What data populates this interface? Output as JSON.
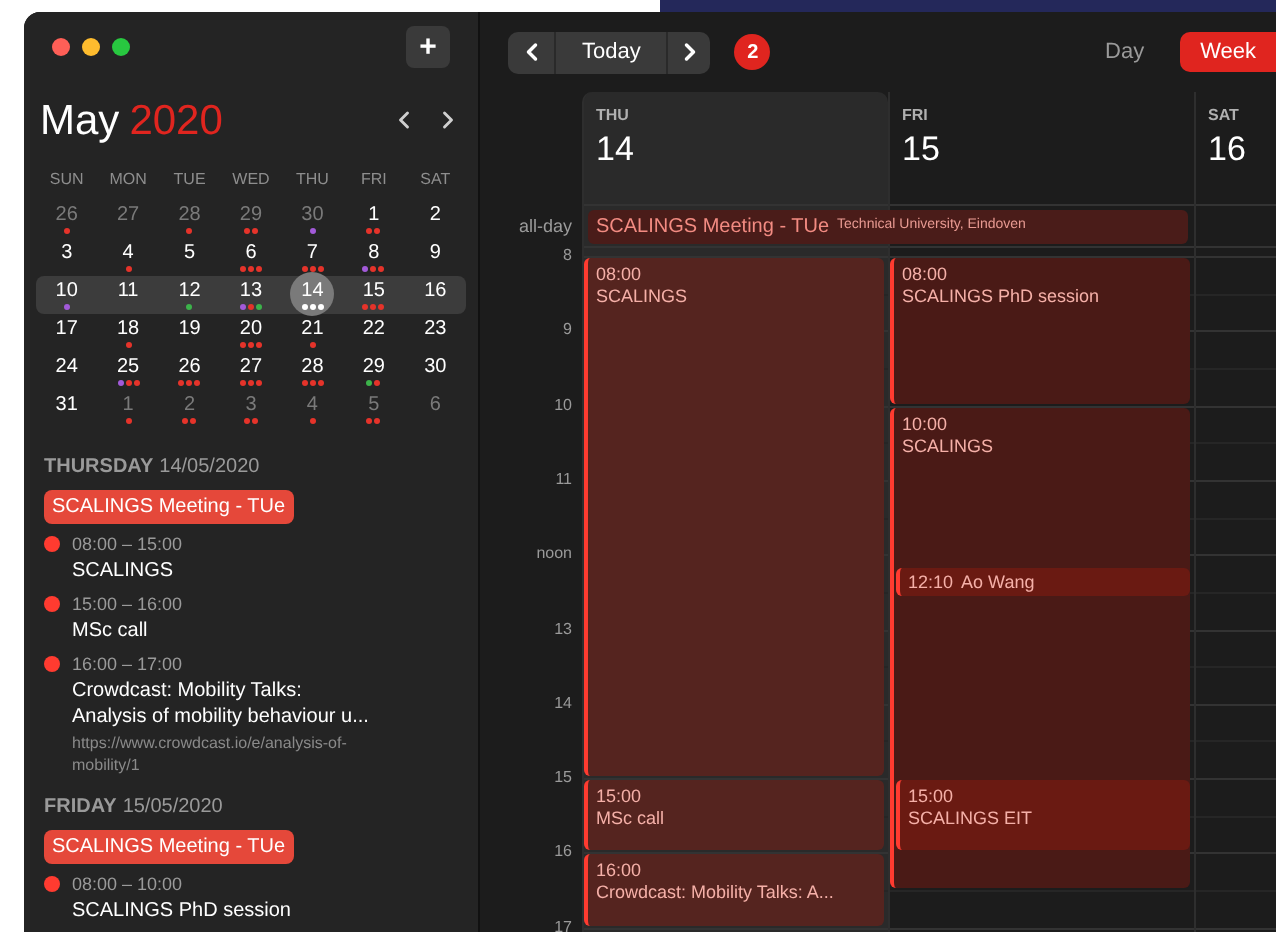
{
  "sidebar": {
    "add_button": "+",
    "month": "May",
    "year": "2020",
    "weekdays": [
      "SUN",
      "MON",
      "TUE",
      "WED",
      "THU",
      "FRI",
      "SAT"
    ],
    "weeks": [
      {
        "selected": false,
        "days": [
          {
            "day": "26",
            "muted": true,
            "selected": false,
            "dots": [
              {
                "color": "#e5332a"
              }
            ]
          },
          {
            "day": "27",
            "muted": true,
            "selected": false
          },
          {
            "day": "28",
            "muted": true,
            "selected": false,
            "dots": [
              {
                "color": "#e5332a"
              }
            ]
          },
          {
            "day": "29",
            "muted": true,
            "selected": false,
            "dots": [
              {
                "color": "#e5332a"
              },
              {
                "color": "#e5332a"
              }
            ]
          },
          {
            "day": "30",
            "muted": true,
            "selected": false,
            "dots": [
              {
                "color": "#a25ad9"
              }
            ]
          },
          {
            "day": "1",
            "muted": false,
            "selected": false,
            "dots": [
              {
                "color": "#e5332a"
              },
              {
                "color": "#e5332a"
              }
            ]
          },
          {
            "day": "2",
            "muted": false,
            "selected": false
          }
        ]
      },
      {
        "selected": false,
        "days": [
          {
            "day": "3",
            "muted": false,
            "selected": false
          },
          {
            "day": "4",
            "muted": false,
            "selected": false,
            "dots": [
              {
                "color": "#e5332a"
              }
            ]
          },
          {
            "day": "5",
            "muted": false,
            "selected": false
          },
          {
            "day": "6",
            "muted": false,
            "selected": false,
            "dots": [
              {
                "color": "#e5332a"
              },
              {
                "color": "#e5332a"
              },
              {
                "color": "#e5332a"
              }
            ]
          },
          {
            "day": "7",
            "muted": false,
            "selected": false,
            "dots": [
              {
                "color": "#e5332a"
              },
              {
                "color": "#e5332a"
              },
              {
                "color": "#e5332a"
              }
            ]
          },
          {
            "day": "8",
            "muted": false,
            "selected": false,
            "dots": [
              {
                "color": "#a25ad9"
              },
              {
                "color": "#e5332a"
              },
              {
                "color": "#e5332a"
              }
            ]
          },
          {
            "day": "9",
            "muted": false,
            "selected": false
          }
        ]
      },
      {
        "selected": true,
        "days": [
          {
            "day": "10",
            "muted": false,
            "selected": false,
            "dots": [
              {
                "color": "#a25ad9"
              }
            ]
          },
          {
            "day": "11",
            "muted": false,
            "selected": false
          },
          {
            "day": "12",
            "muted": false,
            "selected": false,
            "dots": [
              {
                "color": "#3cb34a"
              }
            ]
          },
          {
            "day": "13",
            "muted": false,
            "selected": false,
            "dots": [
              {
                "color": "#a25ad9"
              },
              {
                "color": "#e5332a"
              },
              {
                "color": "#3cb34a"
              }
            ]
          },
          {
            "day": "14",
            "muted": false,
            "selected": true,
            "dots": [
              {
                "color": "#ffffff"
              },
              {
                "color": "#ffffff"
              },
              {
                "color": "#ffffff"
              }
            ]
          },
          {
            "day": "15",
            "muted": false,
            "selected": false,
            "dots": [
              {
                "color": "#e5332a"
              },
              {
                "color": "#e5332a"
              },
              {
                "color": "#e5332a"
              }
            ]
          },
          {
            "day": "16",
            "muted": false,
            "selected": false
          }
        ]
      },
      {
        "selected": false,
        "days": [
          {
            "day": "17",
            "muted": false,
            "selected": false
          },
          {
            "day": "18",
            "muted": false,
            "selected": false,
            "dots": [
              {
                "color": "#e5332a"
              }
            ]
          },
          {
            "day": "19",
            "muted": false,
            "selected": false
          },
          {
            "day": "20",
            "muted": false,
            "selected": false,
            "dots": [
              {
                "color": "#e5332a"
              },
              {
                "color": "#e5332a"
              },
              {
                "color": "#e5332a"
              }
            ]
          },
          {
            "day": "21",
            "muted": false,
            "selected": false,
            "dots": [
              {
                "color": "#e5332a"
              }
            ]
          },
          {
            "day": "22",
            "muted": false,
            "selected": false
          },
          {
            "day": "23",
            "muted": false,
            "selected": false
          }
        ]
      },
      {
        "selected": false,
        "days": [
          {
            "day": "24",
            "muted": false,
            "selected": false
          },
          {
            "day": "25",
            "muted": false,
            "selected": false,
            "dots": [
              {
                "color": "#a25ad9"
              },
              {
                "color": "#e5332a"
              },
              {
                "color": "#e5332a"
              }
            ]
          },
          {
            "day": "26",
            "muted": false,
            "selected": false,
            "dots": [
              {
                "color": "#e5332a"
              },
              {
                "color": "#e5332a"
              },
              {
                "color": "#e5332a"
              }
            ]
          },
          {
            "day": "27",
            "muted": false,
            "selected": false,
            "dots": [
              {
                "color": "#e5332a"
              },
              {
                "color": "#e5332a"
              },
              {
                "color": "#e5332a"
              }
            ]
          },
          {
            "day": "28",
            "muted": false,
            "selected": false,
            "dots": [
              {
                "color": "#e5332a"
              },
              {
                "color": "#e5332a"
              },
              {
                "color": "#e5332a"
              }
            ]
          },
          {
            "day": "29",
            "muted": false,
            "selected": false,
            "dots": [
              {
                "color": "#3cb34a"
              },
              {
                "color": "#e5332a"
              }
            ]
          },
          {
            "day": "30",
            "muted": false,
            "selected": false
          }
        ]
      },
      {
        "selected": false,
        "days": [
          {
            "day": "31",
            "muted": false,
            "selected": false
          },
          {
            "day": "1",
            "muted": true,
            "selected": false,
            "dots": [
              {
                "color": "#e5332a"
              }
            ]
          },
          {
            "day": "2",
            "muted": true,
            "selected": false,
            "dots": [
              {
                "color": "#e5332a"
              },
              {
                "color": "#e5332a"
              }
            ]
          },
          {
            "day": "3",
            "muted": true,
            "selected": false,
            "dots": [
              {
                "color": "#e5332a"
              },
              {
                "color": "#e5332a"
              }
            ]
          },
          {
            "day": "4",
            "muted": true,
            "selected": false,
            "dots": [
              {
                "color": "#e5332a"
              }
            ]
          },
          {
            "day": "5",
            "muted": true,
            "selected": false,
            "dots": [
              {
                "color": "#e5332a"
              },
              {
                "color": "#e5332a"
              }
            ]
          },
          {
            "day": "6",
            "muted": true,
            "selected": false
          }
        ]
      }
    ],
    "agenda": [
      {
        "weekday": "THURSDAY",
        "date": "14/05/2020",
        "all_day": "SCALINGS Meeting - TUe",
        "events": [
          {
            "time": "08:00 – 15:00",
            "title": "SCALINGS"
          },
          {
            "time": "15:00 – 16:00",
            "title": "MSc call"
          },
          {
            "time": "16:00 – 17:00",
            "title": "Crowdcast: Mobility Talks:\nAnalysis of mobility behaviour u...",
            "url": "https://www.crowdcast.io/e/analysis-of-\nmobility/1"
          }
        ]
      },
      {
        "weekday": "FRIDAY",
        "date": "15/05/2020",
        "all_day": "SCALINGS Meeting - TUe",
        "events": [
          {
            "time": "08:00 – 10:00",
            "title": "SCALINGS PhD session"
          }
        ]
      }
    ]
  },
  "toolbar": {
    "today": "Today",
    "badge": "2",
    "views": [
      {
        "label": "Day",
        "selected": false
      },
      {
        "label": "Week",
        "selected": true
      }
    ]
  },
  "week": {
    "all_day_label": "all-day",
    "all_day_event": {
      "title": "SCALINGS Meeting - TUe",
      "location": "Technical University, Eindoven"
    },
    "hours": [
      "8",
      "9",
      "10",
      "11",
      "noon",
      "13",
      "14",
      "15",
      "16",
      "17"
    ],
    "days": [
      {
        "weekday": "THU",
        "date": "14",
        "selected": true,
        "events": [
          {
            "kind": "block",
            "time": "08:00",
            "title": "SCALINGS",
            "overlap": false
          },
          {
            "kind": "block",
            "time": "15:00",
            "title": "MSc call",
            "overlap": false
          },
          {
            "kind": "block",
            "time": "16:00",
            "title": "Crowdcast: Mobility Talks: A...",
            "overlap": false
          }
        ]
      },
      {
        "weekday": "FRI",
        "date": "15",
        "selected": false,
        "events": [
          {
            "kind": "block",
            "time": "08:00",
            "title": "SCALINGS PhD session",
            "overlap": false
          },
          {
            "kind": "block",
            "time": "10:00",
            "title": "SCALINGS",
            "overlap": false
          },
          {
            "kind": "inline",
            "time": "12:10",
            "title": "Ao Wang",
            "overlap": true
          },
          {
            "kind": "block",
            "time": "15:00",
            "title": "SCALINGS EIT",
            "overlap": true
          }
        ]
      },
      {
        "weekday": "SAT",
        "date": "16",
        "selected": false
      }
    ]
  }
}
